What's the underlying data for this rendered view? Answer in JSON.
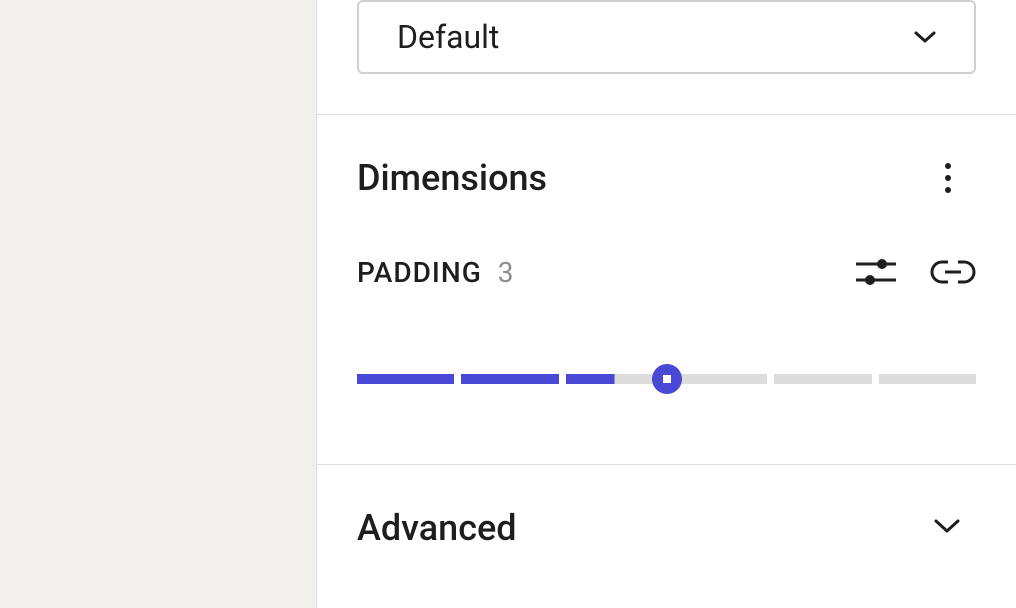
{
  "style_select": {
    "selected": "Default"
  },
  "dimensions": {
    "title": "Dimensions",
    "padding_label": "PADDING",
    "padding_value": "3",
    "slider_segments": 6,
    "slider_filled": 3,
    "slider_position_pct": 50,
    "colors": {
      "accent": "#4a49d6",
      "track_empty": "#dcdcdc"
    }
  },
  "advanced": {
    "title": "Advanced"
  }
}
